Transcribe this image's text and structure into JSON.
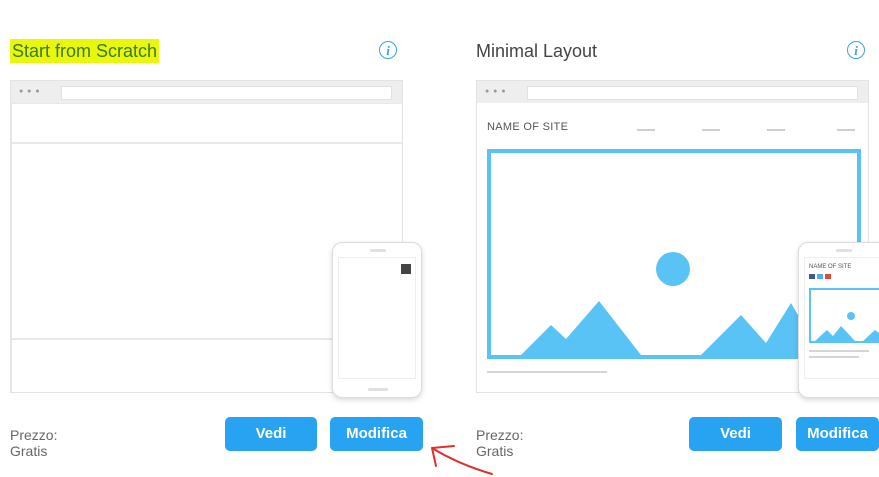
{
  "cards": [
    {
      "title": "Start from Scratch",
      "highlighted": true,
      "price_label": "Prezzo: Gratis",
      "view_label": "Vedi",
      "edit_label": "Modifica"
    },
    {
      "title": "Minimal Layout",
      "highlighted": false,
      "site_name": "NAME OF SITE",
      "phone_site_name": "NAME OF SITE",
      "price_label": "Prezzo: Gratis",
      "view_label": "Vedi",
      "edit_label": "Modifica"
    }
  ],
  "colors": {
    "accent": "#27a3f1",
    "hero_border": "#5ac3f5",
    "highlight": "#e9f70c",
    "annotation_arrow": "#e0302a"
  },
  "icons": [
    "info-icon",
    "image-placeholder-sun",
    "mountains-illustration",
    "annotation-arrow"
  ]
}
